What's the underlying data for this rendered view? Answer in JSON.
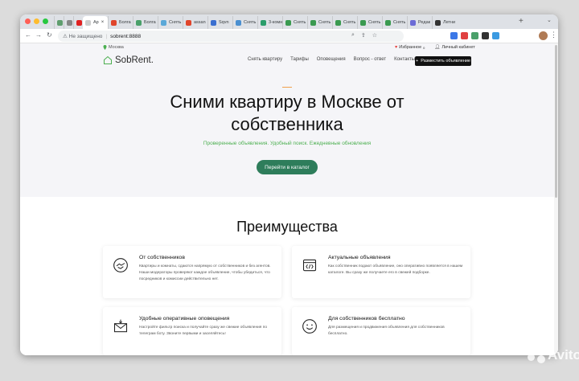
{
  "browser": {
    "tabs": [
      {
        "label": "",
        "color": "#5f9e6e"
      },
      {
        "label": "",
        "color": "#888888"
      },
      {
        "label": "",
        "color": "#e02020"
      },
      {
        "label": "Ap",
        "color": "#cccccc",
        "active": true
      },
      {
        "label": "Болга",
        "color": "#e0452b"
      },
      {
        "label": "Болга",
        "color": "#4aa06a"
      },
      {
        "label": "Снять",
        "color": "#5aa8d8"
      },
      {
        "label": "assan",
        "color": "#e0452b"
      },
      {
        "label": "Sqvn",
        "color": "#3b6fd0"
      },
      {
        "label": "Снять",
        "color": "#4a8fd0"
      },
      {
        "label": "3-комн",
        "color": "#2a9d6b"
      },
      {
        "label": "Снять",
        "color": "#3a9a50"
      },
      {
        "label": "Снять",
        "color": "#3a9a50"
      },
      {
        "label": "Снять",
        "color": "#3a9a50"
      },
      {
        "label": "Снять",
        "color": "#3a9a50"
      },
      {
        "label": "Снять",
        "color": "#3a9a50"
      },
      {
        "label": "Редак",
        "color": "#6b6bd6"
      },
      {
        "label": "Летни",
        "color": "#333333"
      }
    ],
    "address": {
      "security": "Не защищено",
      "url": "sobrent:8888"
    },
    "extension_colors": [
      "#3b78e7",
      "#e04040",
      "#4aa06a",
      "#333333",
      "#3b9ae1"
    ]
  },
  "site": {
    "city": "Москва",
    "favorites": "Избранное",
    "favorites_count": "0",
    "cabinet": "Личный кабинет",
    "logo": "SobRent.",
    "nav": [
      "Снять квартиру",
      "Тарифы",
      "Оповещения",
      "Вопрос - ответ",
      "Контакты"
    ],
    "post_button": "Разместить объявление",
    "hero_title": "Сними квартиру в Москве от собственника",
    "hero_subtitle": "Проверенные объявления. Удобный поиск. Ежедневные обновления",
    "hero_button": "Перейти в каталог",
    "advantages_title": "Преимущества",
    "cards": [
      {
        "icon": "handshake-icon",
        "title": "От собственников",
        "text": "Квартиры и комнаты, сдаются напрямую от собственников и без агентов. Наши модераторы проверяют каждое объявление, чтобы убедиться, что посредников и комиссии действительно нет."
      },
      {
        "icon": "code-window-icon",
        "title": "Актуальные объявления",
        "text": "Как собственник подают объявление, оно оперативно появляется в нашем каталоге. Вы сразу же получаете его в свежей подборке."
      },
      {
        "icon": "mail-notification-icon",
        "title": "Удобные оперативные оповещения",
        "text": "Настройте фильтр поиска и получайте сразу же свежие объявления по телеграм боту. Звоните первыми и заселяйтесь!"
      },
      {
        "icon": "smile-icon",
        "title": "Для собственников бесплатно",
        "text": "Для размещения и продвижения объявления для собственников бесплатно."
      }
    ]
  },
  "watermark": "Avito",
  "colors": {
    "accent_green": "#2e7d5b",
    "subtitle_green": "#4caf50",
    "hero_bg": "#f5f5f8",
    "accent_orange": "#f0a04b"
  }
}
